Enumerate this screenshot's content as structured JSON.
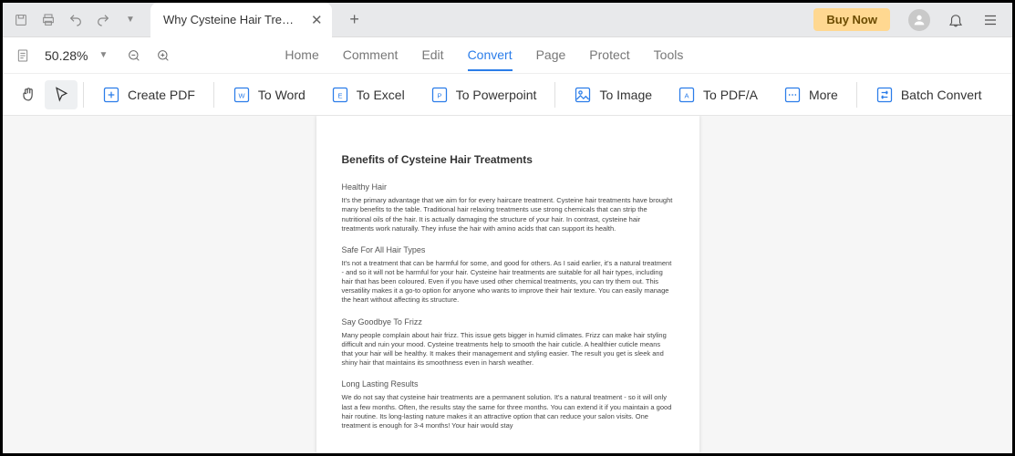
{
  "titlebar": {
    "tab_title": "Why Cysteine Hair Treat...",
    "buy_now": "Buy Now"
  },
  "menubar": {
    "zoom": "50.28%",
    "items": [
      "Home",
      "Comment",
      "Edit",
      "Convert",
      "Page",
      "Protect",
      "Tools"
    ],
    "active_index": 3
  },
  "toolbar": {
    "create_pdf": "Create PDF",
    "to_word": "To Word",
    "to_excel": "To Excel",
    "to_ppt": "To Powerpoint",
    "to_image": "To Image",
    "to_pdfa": "To PDF/A",
    "more": "More",
    "batch": "Batch Convert"
  },
  "document": {
    "title": "Benefits of Cysteine Hair Treatments",
    "sections": [
      {
        "heading": "Healthy Hair",
        "body": "It's the primary advantage that we aim for for every haircare treatment. Cysteine hair treatments have brought many benefits to the table. Traditional hair relaxing treatments use strong chemicals that can strip the nutritional oils of the hair. It is actually damaging the structure of your hair. In contrast, cysteine hair treatments work naturally. They infuse the hair with amino acids that can support its health."
      },
      {
        "heading": "Safe For All Hair Types",
        "body": "It's not a treatment that can be harmful for some, and good for others. As I said earlier, it's a natural treatment - and so it will not be harmful for your hair. Cysteine hair treatments are suitable for all hair types, including hair that has been coloured. Even if you have used other chemical treatments, you can try them out. This versatility makes it a go-to option for anyone who wants to improve their hair texture. You can easily manage the heart without affecting its structure."
      },
      {
        "heading": "Say Goodbye To Frizz",
        "body": "Many people complain about hair frizz. This issue gets bigger in humid climates. Frizz can make hair styling difficult and ruin your mood. Cysteine treatments help to smooth the hair cuticle. A healthier cuticle means that your hair will be healthy. It makes their management and styling easier. The result you get is sleek and shiny hair that maintains its smoothness even in harsh weather."
      },
      {
        "heading": "Long Lasting Results",
        "body": "We do not say that cysteine hair treatments are a permanent solution. It's a natural treatment - so it will only last a few months. Often, the results stay the same for three months. You can extend it if you maintain a good hair routine. Its long-lasting nature makes it an attractive option that can reduce your salon visits. One treatment is enough for 3-4 months! Your hair would stay"
      }
    ]
  }
}
